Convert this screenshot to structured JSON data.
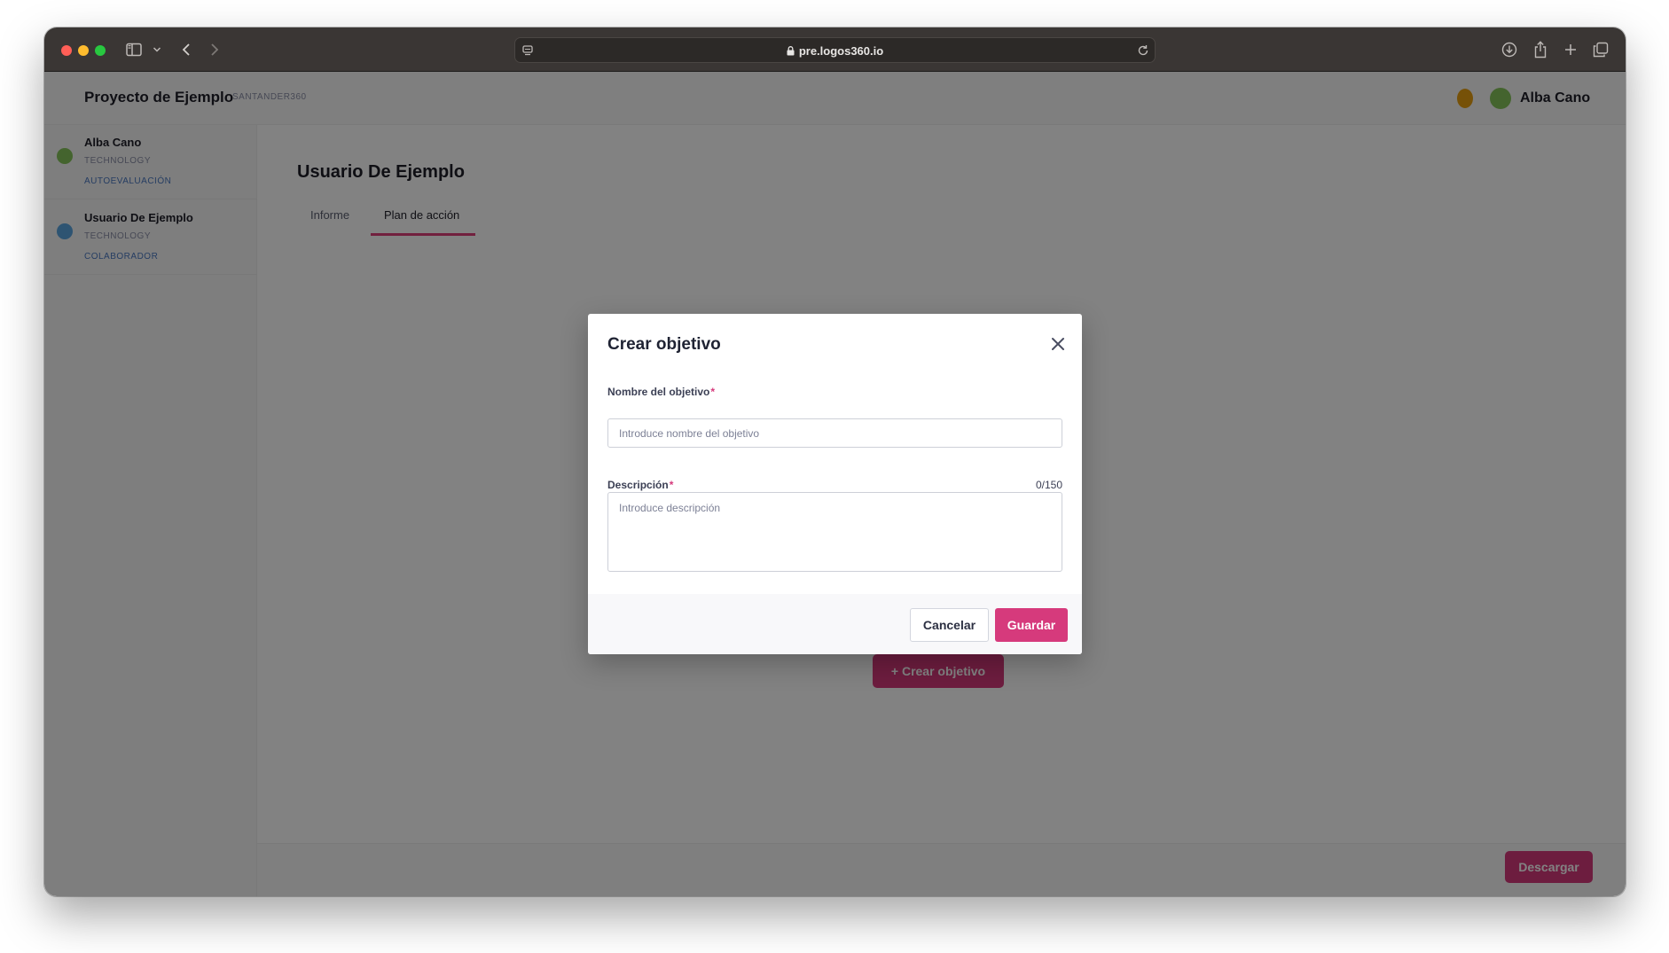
{
  "browser": {
    "url": "pre.logos360.io"
  },
  "header": {
    "project_title": "Proyecto de Ejemplo",
    "project_subtitle": "SANTANDER360",
    "user_name": "Alba Cano"
  },
  "sidebar": {
    "items": [
      {
        "name": "Alba Cano",
        "line1": "TECHNOLOGY",
        "line2": "AUTOEVALUACIÓN"
      },
      {
        "name": "Usuario De Ejemplo",
        "line1": "TECHNOLOGY",
        "line2": "COLABORADOR"
      }
    ]
  },
  "main": {
    "title": "Usuario De Ejemplo",
    "tabs": [
      {
        "label": "Informe"
      },
      {
        "label": "Plan de acción"
      }
    ],
    "empty_title": "",
    "empty_desc": "",
    "create_button": "+ Crear objetivo",
    "download_button": "Descargar"
  },
  "modal": {
    "title": "Crear objetivo",
    "name_label": "Nombre del objetivo",
    "name_placeholder": "Introduce nombre del objetivo",
    "name_value": "",
    "required_mark": "*",
    "desc_label": "Descripción",
    "desc_placeholder": "Introduce descripción",
    "desc_value": "",
    "counter": "0/150",
    "cancel_label": "Cancelar",
    "save_label": "Guardar"
  },
  "colors": {
    "accent": "#d63a7c",
    "titlebar": "#3a3634"
  }
}
